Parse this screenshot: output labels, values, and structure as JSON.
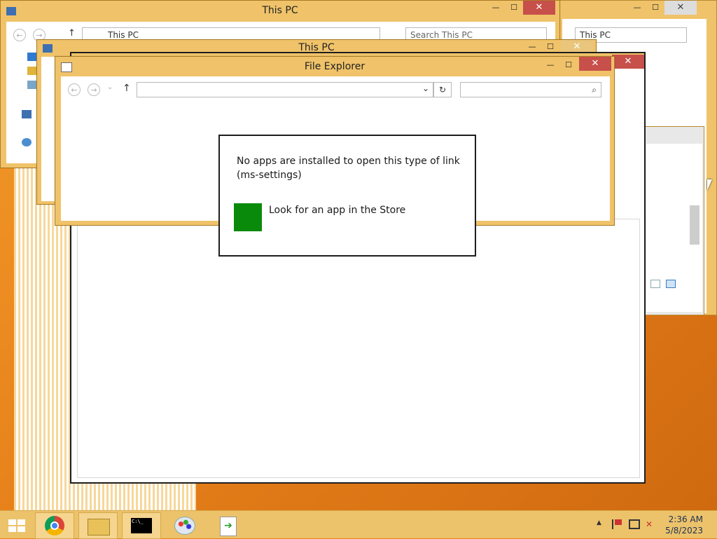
{
  "windows": {
    "back": {
      "title": "This PC",
      "address": "This PC",
      "search_placeholder": "Search This PC"
    },
    "middle": {
      "title": "This PC"
    },
    "front": {
      "title": "File Explorer"
    },
    "right_ghost": {
      "search_placeholder": "This PC"
    }
  },
  "dialog": {
    "message": "No apps are installed to open this type of link (ms-settings)",
    "store_option": "Look for an app in the Store",
    "store_tile_color": "#0a8a0a"
  },
  "buttons": {
    "minimize": "—",
    "maximize": "☐",
    "close": "✕"
  },
  "nav": {
    "back": "←",
    "forward": "→",
    "up": "↑",
    "refresh": "↻",
    "dropdown": "⌄",
    "search": "⌕"
  },
  "taskbar": {
    "apps": [
      "start-icon",
      "chrome-icon",
      "file-explorer-icon",
      "command-prompt-icon",
      "paint-icon",
      "setup-icon"
    ],
    "cmd_label": "C:\\_",
    "time": "2:36 AM",
    "date": "5/8/2023",
    "show_hidden": "▲"
  },
  "colors": {
    "title_bar": "#f0c36a",
    "close": "#c7504a",
    "taskbar": "#ecc36b",
    "desktop": "#e6801a"
  }
}
